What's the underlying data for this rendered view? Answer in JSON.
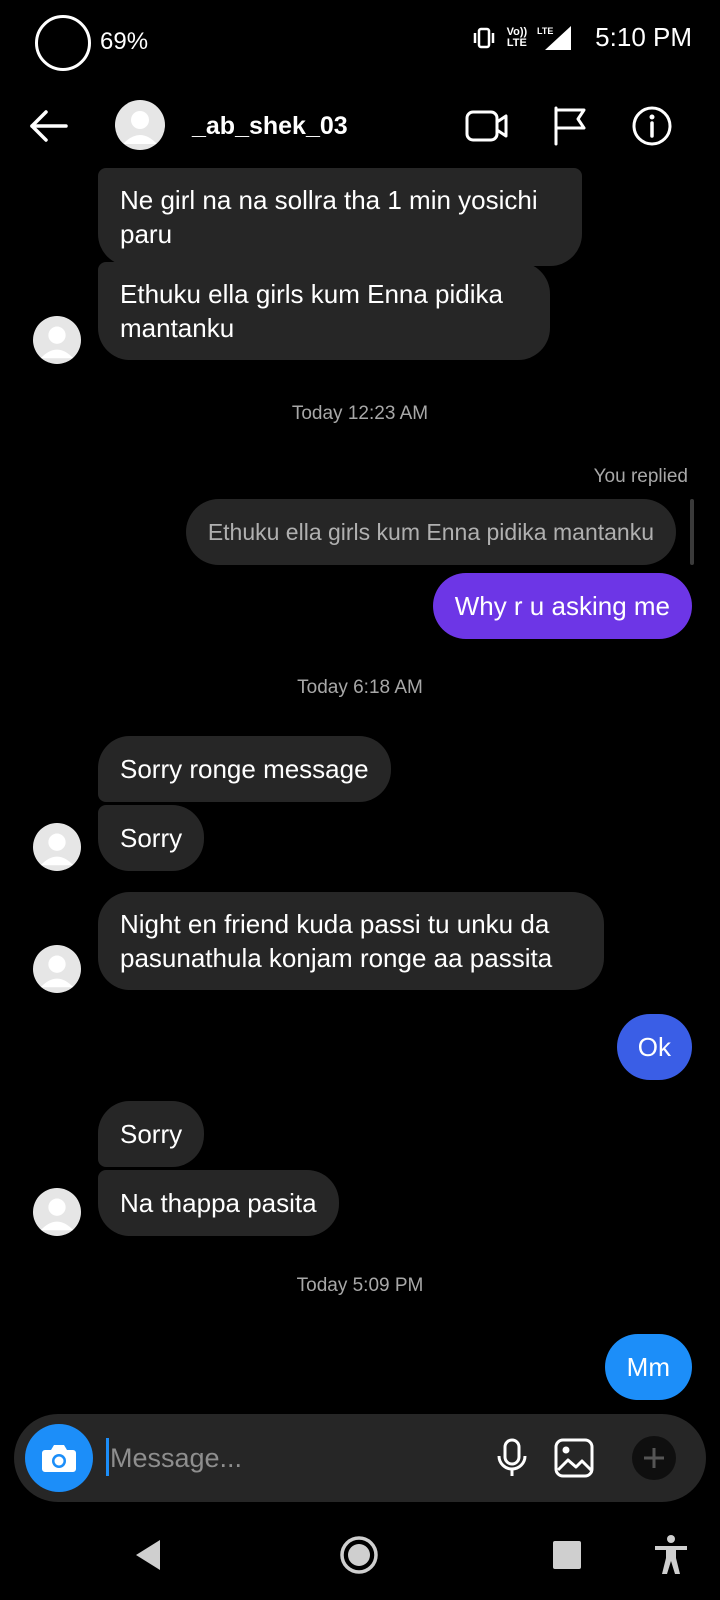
{
  "status_bar": {
    "battery_percent": "69%",
    "network_label_top": "Vo))",
    "network_label_bottom": "LTE",
    "lte_small": "LTE",
    "time": "5:10 PM",
    "icons": [
      "battery-ring-icon",
      "vibrate-icon",
      "volte-icon",
      "signal-icon"
    ]
  },
  "header": {
    "username": "_ab_shek_03",
    "icons": [
      "back-arrow-icon",
      "avatar",
      "video-call-icon",
      "flag-icon",
      "info-icon"
    ]
  },
  "messages": {
    "m1": "Ne girl na na sollra tha 1 min yosichi paru",
    "m2": "Ethuku ella girls kum  Enna pidika mantanku",
    "ts1": "Today 12:23 AM",
    "you_replied": "You replied",
    "quoted": "Ethuku ella girls kum  Enna pidika mantanku",
    "sent1": "Why r u asking me",
    "ts2": "Today 6:18 AM",
    "m3": "Sorry ronge message",
    "m4": "Sorry",
    "m5": "Night en friend kuda passi tu unku da pasunathula konjam ronge aa passita",
    "sent2": "Ok",
    "m6": "Sorry",
    "m7": "Na thappa pasita",
    "ts3": "Today 5:09 PM",
    "sent3": "Mm"
  },
  "composer": {
    "placeholder": "Message...",
    "value": "",
    "icons": [
      "camera-icon",
      "microphone-icon",
      "gallery-icon",
      "plus-icon"
    ]
  },
  "nav": {
    "icons": [
      "nav-back-icon",
      "nav-home-icon",
      "nav-recents-icon",
      "accessibility-icon"
    ]
  },
  "colors": {
    "background": "#000000",
    "received_bubble": "#262626",
    "sent_purple": "#6d36e6",
    "sent_indigo": "#3a5ee6",
    "sent_blue": "#1c8ef9",
    "muted_text": "#a8a8a8"
  }
}
